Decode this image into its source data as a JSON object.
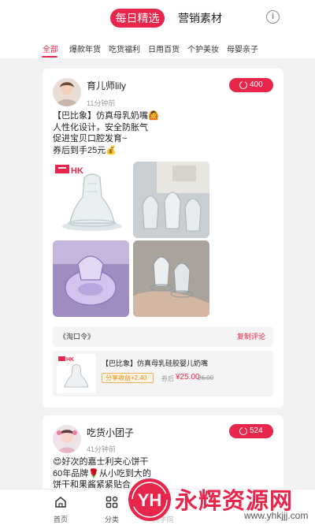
{
  "header": {
    "tabs": [
      {
        "label": "每日精选",
        "active": true
      },
      {
        "label": "营销素材",
        "active": false
      }
    ],
    "info_icon": "info-circle-icon"
  },
  "categories": [
    {
      "label": "全部",
      "active": true
    },
    {
      "label": "爆款年货"
    },
    {
      "label": "吃货福利"
    },
    {
      "label": "日用百货"
    },
    {
      "label": "个护美妆"
    },
    {
      "label": "母婴亲子"
    }
  ],
  "posts": [
    {
      "user": "育儿师lily",
      "time": "11分钟前",
      "share_count": "400",
      "text_lines": [
        "【巴比象】仿真母乳奶嘴🙆",
        "人性化设计，安全防胀气",
        "促进宝贝口腔发育~",
        "券后到手25元💰"
      ],
      "photo_logo": "HK",
      "tao_code": "《淘口令》",
      "copy_label": "复制评论",
      "product": {
        "title": "【巴比象】仿真母乳硅胶婴儿奶嘴",
        "earn_label": "分享收益",
        "earn_amount": "+2.40",
        "after_coupon_label": "券后",
        "price": "¥25.00",
        "original_price": "26.00",
        "thumb_logo": "HK"
      }
    },
    {
      "user": "吃货小团子",
      "time": "41分钟前",
      "share_count": "524",
      "text_lines": [
        "😍好次的嘉士利夹心饼干",
        "60年品牌🌹从小吃到大的",
        "饼干和果酱紧紧贴合"
      ]
    }
  ],
  "tabbar": [
    {
      "label": "首页",
      "icon": "home-icon"
    },
    {
      "label": "分类",
      "icon": "grid-icon"
    },
    {
      "label": "商学院",
      "icon": "school-icon"
    }
  ],
  "watermark": {
    "logo": "YH",
    "text": "永辉资源网",
    "url": "www.yhkjjj.com"
  },
  "colors": {
    "accent": "#e8264b",
    "background": "#f2f2f2",
    "earn": "#e38b10"
  }
}
